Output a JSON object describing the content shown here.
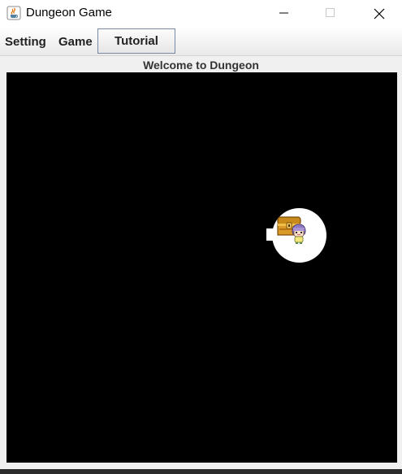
{
  "window": {
    "title": "Dungeon Game",
    "app_icon": "java-coffee-icon",
    "controls": [
      "minimize-icon",
      "maximize-icon",
      "close-icon"
    ]
  },
  "menubar": {
    "items": [
      {
        "label": "Setting"
      },
      {
        "label": "Game"
      },
      {
        "label": "Tutorial",
        "selected": true
      }
    ]
  },
  "header": {
    "welcome": "Welcome to Dungeon"
  },
  "game": {
    "background": "#000000",
    "light_color": "#ffffff",
    "visible_entities": [
      "treasure-chest-icon",
      "player-character-icon"
    ]
  }
}
